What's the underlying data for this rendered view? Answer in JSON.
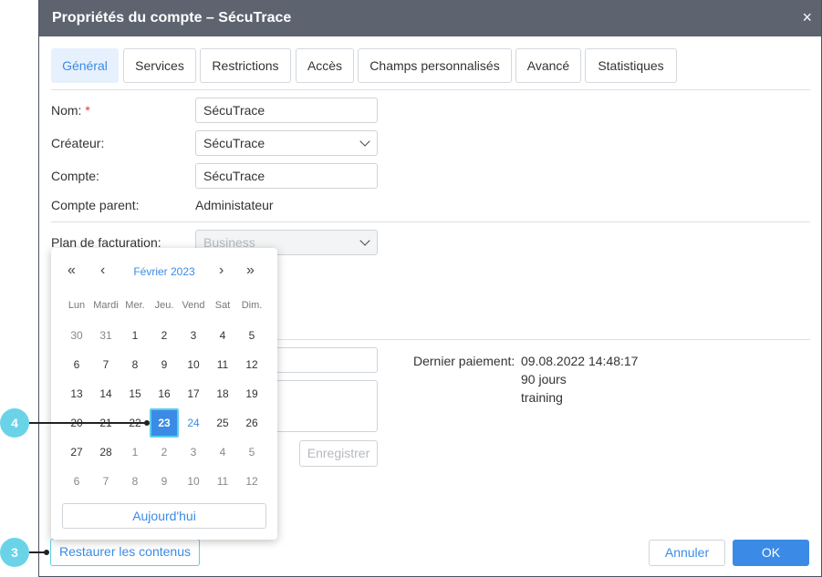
{
  "dialog": {
    "title": "Propriétés du compte – SécuTrace",
    "close": "×"
  },
  "tabs": [
    {
      "label": "Général",
      "active": true
    },
    {
      "label": "Services"
    },
    {
      "label": "Restrictions"
    },
    {
      "label": "Accès"
    },
    {
      "label": "Champs personnalisés"
    },
    {
      "label": "Avancé"
    },
    {
      "label": "Statistiques"
    }
  ],
  "form": {
    "name_label": "Nom:",
    "required_mark": "*",
    "name_value": "SécuTrace",
    "creator_label": "Créateur:",
    "creator_value": "SécuTrace",
    "account_label": "Compte:",
    "account_value": "SécuTrace",
    "parent_label": "Compte parent:",
    "parent_value": "Administateur",
    "plan_label": "Plan de facturation:",
    "plan_value": "Business"
  },
  "payment": {
    "label": "Dernier paiement:",
    "date": "09.08.2022 14:48:17",
    "days": "90 jours",
    "note": "training",
    "save_label": "Enregistrer"
  },
  "calendar": {
    "prev_year": "«",
    "prev_month": "‹",
    "month": "Février 2023",
    "next_month": "›",
    "next_year": "»",
    "weekdays": [
      "Lun",
      "Mardi",
      "Mer.",
      "Jeu.",
      "Vend",
      "Sat",
      "Dim."
    ],
    "weeks": [
      [
        "30",
        "31",
        "1",
        "2",
        "3",
        "4",
        "5"
      ],
      [
        "6",
        "7",
        "8",
        "9",
        "10",
        "11",
        "12"
      ],
      [
        "13",
        "14",
        "15",
        "16",
        "17",
        "18",
        "19"
      ],
      [
        "20",
        "21",
        "22",
        "23",
        "24",
        "25",
        "26"
      ],
      [
        "27",
        "28",
        "1",
        "2",
        "3",
        "4",
        "5"
      ],
      [
        "6",
        "7",
        "8",
        "9",
        "10",
        "11",
        "12"
      ]
    ],
    "selected": "23",
    "today": "24",
    "today_label": "Aujourd'hui"
  },
  "footer": {
    "restore_label": "Restaurer les contenus",
    "cancel_label": "Annuler",
    "ok_label": "OK"
  },
  "callouts": [
    {
      "number": "4"
    },
    {
      "number": "3"
    }
  ],
  "colors": {
    "accent": "#3b8be6",
    "titlebar": "#5d6470",
    "callout": "#6ad3e8"
  }
}
